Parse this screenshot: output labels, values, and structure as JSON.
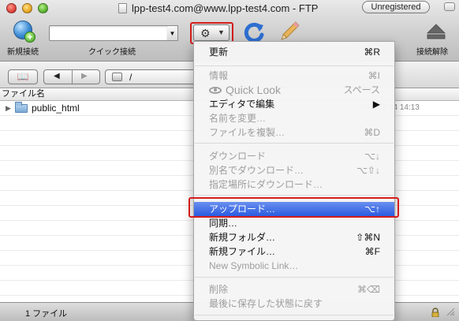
{
  "window": {
    "title": "lpp-test4.com@www.lpp-test4.com - FTP",
    "badge": "Unregistered"
  },
  "toolbar": {
    "new_connection": "新規接続",
    "quick_connect": "クイック接続",
    "quick_connect_value": "",
    "disconnect": "接続解除",
    "action_gear": "⚙",
    "action_arrow": "▼"
  },
  "pathbar": {
    "book_glyph": "📖",
    "back_glyph": "◀",
    "forward_glyph": "▶",
    "path": "/"
  },
  "list": {
    "column_filename": "ファイル名",
    "rows": [
      {
        "name": "public_html",
        "date_fragment": "2014/02/24 14:13"
      }
    ]
  },
  "status": {
    "text": "1 ファイル"
  },
  "menu": {
    "items": [
      {
        "label": "更新",
        "shortcut": "⌘R",
        "enabled": true
      },
      {
        "label": "情報",
        "shortcut": "⌘I",
        "enabled": false
      },
      {
        "label": "Quick Look",
        "shortcut": "スペース",
        "enabled": false
      },
      {
        "label": "エディタで編集",
        "shortcut": "▶",
        "enabled": true
      },
      {
        "label": "名前を変更…",
        "shortcut": "",
        "enabled": false
      },
      {
        "label": "ファイルを複製…",
        "shortcut": "⌘D",
        "enabled": false
      },
      {
        "label": "ダウンロード",
        "shortcut": "⌥↓",
        "enabled": false
      },
      {
        "label": "別名でダウンロード…",
        "shortcut": "⌥⇧↓",
        "enabled": false
      },
      {
        "label": "指定場所にダウンロード…",
        "shortcut": "",
        "enabled": false
      },
      {
        "label": "アップロード…",
        "shortcut": "⌥↑",
        "enabled": true,
        "selected": true
      },
      {
        "label": "同期…",
        "shortcut": "",
        "enabled": true
      },
      {
        "label": "新規フォルダ…",
        "shortcut": "⇧⌘N",
        "enabled": true
      },
      {
        "label": "新規ファイル…",
        "shortcut": "⌘F",
        "enabled": true
      },
      {
        "label": "New Symbolic Link…",
        "shortcut": "",
        "enabled": false
      },
      {
        "label": "削除",
        "shortcut": "⌘⌫",
        "enabled": false
      },
      {
        "label": "最後に保存した状態に戻す",
        "shortcut": "",
        "enabled": false
      }
    ]
  },
  "colors": {
    "highlight": "#2a5be0",
    "annotation_red": "#d41c1c"
  }
}
